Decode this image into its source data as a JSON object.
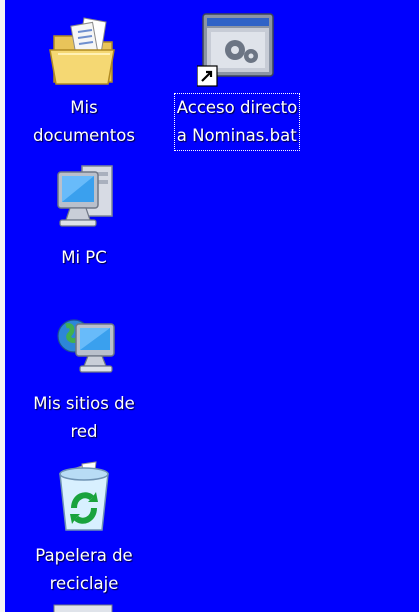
{
  "desktop": {
    "background_color": "#0000fe",
    "icons": [
      {
        "label": "Mis\ndocumentos",
        "icon": "my-documents-folder-icon"
      },
      {
        "label": "Mi PC",
        "icon": "my-computer-icon"
      },
      {
        "label": "Mis sitios de\nred",
        "icon": "network-places-icon"
      },
      {
        "label": "Papelera de\nreciclaje",
        "icon": "recycle-bin-icon"
      },
      {
        "label": "Acceso directo\na Nominas.bat",
        "icon": "batch-file-shortcut-icon",
        "selected": true
      }
    ]
  }
}
